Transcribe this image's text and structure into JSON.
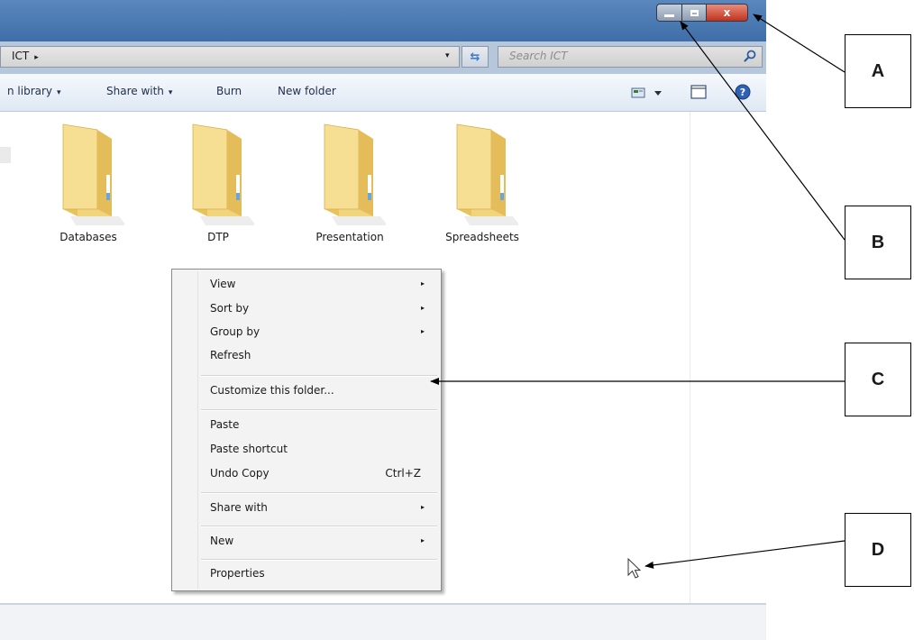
{
  "window": {
    "controls": {
      "minimize": "minimize",
      "maximize": "maximize",
      "close": "x"
    }
  },
  "address_bar": {
    "breadcrumb": "ICT",
    "crumb_arrow": "▸",
    "dropdown_arrow": "▾",
    "search_placeholder": "Search ICT"
  },
  "toolbar": {
    "include_in_library": "n library",
    "share_with": "Share with",
    "burn": "Burn",
    "new_folder": "New folder",
    "caret": "▾"
  },
  "folders": [
    {
      "label": "Databases"
    },
    {
      "label": "DTP"
    },
    {
      "label": "Presentation"
    },
    {
      "label": "Spreadsheets"
    }
  ],
  "context_menu": {
    "items": [
      {
        "label": "View",
        "submenu": true
      },
      {
        "label": "Sort by",
        "submenu": true
      },
      {
        "label": "Group by",
        "submenu": true
      },
      {
        "label": "Refresh"
      },
      {
        "label": "Customize this folder..."
      },
      {
        "label": "Paste"
      },
      {
        "label": "Paste shortcut"
      },
      {
        "label": "Undo Copy",
        "shortcut": "Ctrl+Z"
      },
      {
        "label": "Share with",
        "submenu": true
      },
      {
        "label": "New",
        "submenu": true
      },
      {
        "label": "Properties"
      }
    ],
    "submenu_arrow": "▸"
  },
  "annotations": {
    "a": "A",
    "b": "B",
    "c": "C",
    "d": "D"
  },
  "colors": {
    "titlebar": "#4a7ab3",
    "close_button": "#c2321d",
    "folder": "#f2d27a"
  }
}
